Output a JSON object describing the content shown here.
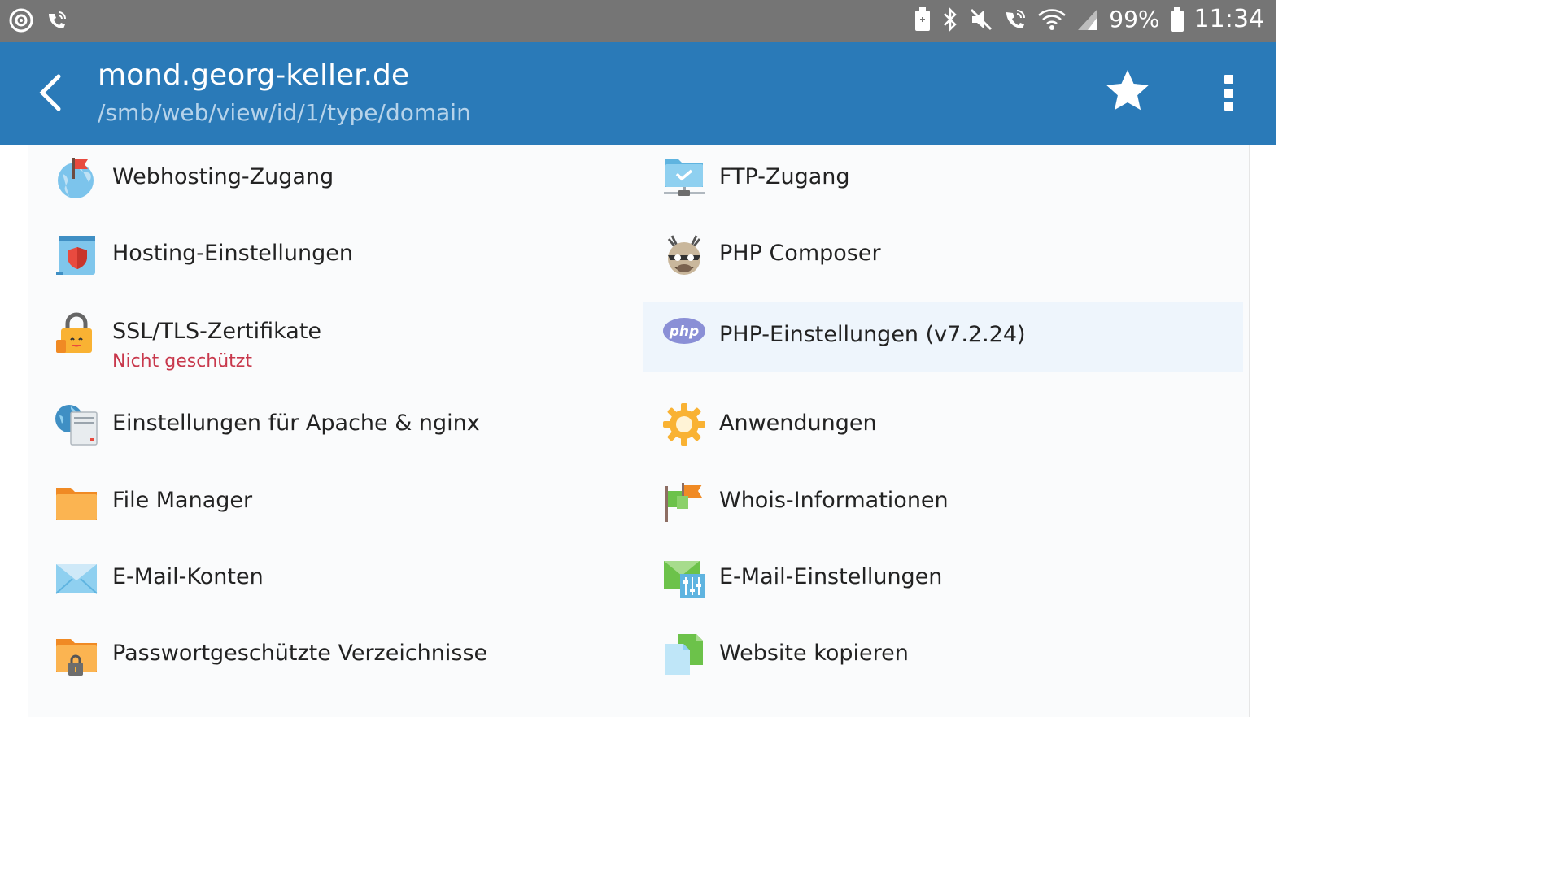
{
  "status_bar": {
    "left_icons": [
      "target-icon",
      "wifi-call-icon"
    ],
    "right_icons": [
      "battery-saver-icon",
      "bluetooth-icon",
      "mute-icon",
      "wifi-call-icon",
      "wifi-icon",
      "signal-icon"
    ],
    "battery": "99%",
    "time": "11:34"
  },
  "header": {
    "title": "mond.georg-keller.de",
    "subtitle": "/smb/web/view/id/1/type/domain",
    "colors": {
      "bar": "#2a7ab8",
      "subtitle": "#b6d3ea"
    }
  },
  "menu": {
    "left": [
      {
        "label": "Webhosting-Zugang",
        "icon": "globe-flag-icon"
      },
      {
        "label": "Hosting-Einstellungen",
        "icon": "shield-document-icon"
      },
      {
        "label": "SSL/TLS-Zertifikate",
        "sublabel": "Nicht geschützt",
        "icon": "padlock-icon"
      },
      {
        "label": "Einstellungen für Apache & nginx",
        "icon": "web-server-icon"
      },
      {
        "label": "File Manager",
        "icon": "folder-icon"
      },
      {
        "label": "E-Mail-Konten",
        "icon": "envelope-icon"
      },
      {
        "label": "Passwortgeschützte Verzeichnisse",
        "icon": "locked-folder-icon"
      }
    ],
    "right": [
      {
        "label": "FTP-Zugang",
        "icon": "ftp-folder-icon"
      },
      {
        "label": "PHP Composer",
        "icon": "composer-icon"
      },
      {
        "label": "PHP-Einstellungen (v7.2.24)",
        "icon": "php-icon",
        "icon_text": "php"
      },
      {
        "label": "Anwendungen",
        "icon": "gear-icon"
      },
      {
        "label": "Whois-Informationen",
        "icon": "flags-icon"
      },
      {
        "label": "E-Mail-Einstellungen",
        "icon": "mail-settings-icon"
      },
      {
        "label": "Website kopieren",
        "icon": "copy-document-icon"
      }
    ]
  },
  "colors": {
    "warning": "#c8384c",
    "highlight": "#eef5fc"
  }
}
